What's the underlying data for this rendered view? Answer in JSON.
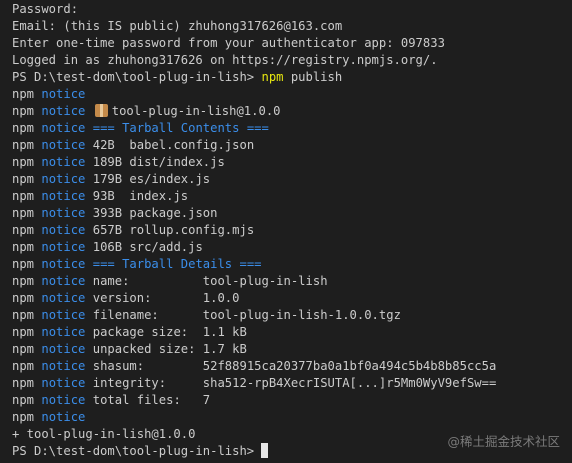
{
  "terminal": {
    "pre_lines": [
      "Password:",
      "Email: (this IS public) zhuhong317626@163.com",
      "Enter one-time password from your authenticator app: 097833",
      "Logged in as zhuhong317626 on https://registry.npmjs.org/."
    ],
    "prompt1": {
      "prefix": "PS D:\\test-dom\\tool-plug-in-lish> ",
      "command": "npm",
      "args": " publish"
    },
    "npm_word": "npm",
    "notice_word": "notice",
    "notices": [
      {
        "text": "",
        "kind": "text"
      },
      {
        "text": "tool-plug-in-lish@1.0.0",
        "kind": "package",
        "icon": "package-icon"
      },
      {
        "text": "=== Tarball Contents ===",
        "kind": "header"
      },
      {
        "text": "42B  babel.config.json",
        "kind": "text"
      },
      {
        "text": "189B dist/index.js",
        "kind": "text"
      },
      {
        "text": "179B es/index.js",
        "kind": "text"
      },
      {
        "text": "93B  index.js",
        "kind": "text"
      },
      {
        "text": "393B package.json",
        "kind": "text"
      },
      {
        "text": "657B rollup.config.mjs",
        "kind": "text"
      },
      {
        "text": "106B src/add.js",
        "kind": "text"
      },
      {
        "text": "=== Tarball Details ===",
        "kind": "header"
      },
      {
        "text": "name:          tool-plug-in-lish",
        "kind": "text"
      },
      {
        "text": "version:       1.0.0",
        "kind": "text"
      },
      {
        "text": "filename:      tool-plug-in-lish-1.0.0.tgz",
        "kind": "text"
      },
      {
        "text": "package size:  1.1 kB",
        "kind": "text"
      },
      {
        "text": "unpacked size: 1.7 kB",
        "kind": "text"
      },
      {
        "text": "shasum:        52f88915ca20377ba0a1bf0a494c5b4b8b85cc5a",
        "kind": "text"
      },
      {
        "text": "integrity:     sha512-rpB4XecrISUTA[...]r5Mm0WyV9efSw==",
        "kind": "text"
      },
      {
        "text": "total files:   7",
        "kind": "text"
      },
      {
        "text": "",
        "kind": "text"
      }
    ],
    "result_line": "+ tool-plug-in-lish@1.0.0",
    "prompt2": {
      "prefix": "PS D:\\test-dom\\tool-plug-in-lish> "
    }
  },
  "watermark": "@稀土掘金技术社区",
  "colors": {
    "background": "#1e1e1e",
    "text": "#cccccc",
    "notice": "#3b8eea",
    "command": "#e5e510"
  }
}
